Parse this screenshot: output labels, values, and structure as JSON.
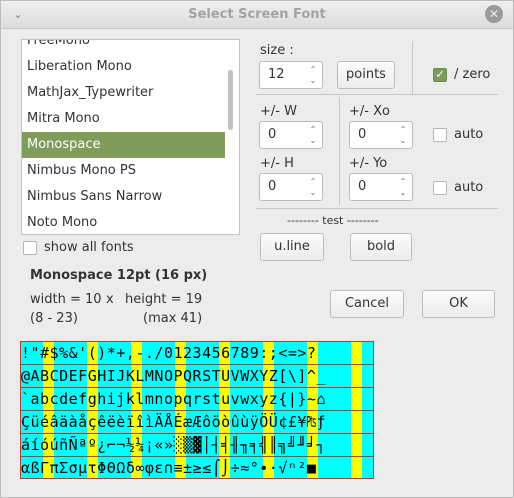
{
  "window": {
    "title": "Select Screen Font",
    "menu_icon": "chevron-down-icon",
    "close_icon": "close-icon"
  },
  "font_list": {
    "items": [
      "FreeMono",
      "Liberation Mono",
      "MathJax_Typewriter",
      "Mitra Mono",
      "Monospace",
      "Nimbus Mono PS",
      "Nimbus Sans Narrow",
      "Noto Mono"
    ],
    "selected": "Monospace"
  },
  "show_all_fonts": {
    "label": "show all fonts",
    "checked": false
  },
  "size": {
    "label": "size :",
    "value": "12",
    "unit_button": "points"
  },
  "zero": {
    "label": "/ zero",
    "checked": true
  },
  "w": {
    "label": "+/- W",
    "value": "0"
  },
  "h": {
    "label": "+/- H",
    "value": "0"
  },
  "xo": {
    "label": "+/- Xo",
    "value": "0",
    "auto_label": "auto"
  },
  "yo": {
    "label": "+/- Yo",
    "value": "0",
    "auto_label": "auto"
  },
  "test": {
    "label": "-------- test --------",
    "uline": "u.line",
    "bold": "bold"
  },
  "info": {
    "font_line": "Monospace  12pt  (16 px)",
    "width": "width = 10",
    "x": "x",
    "height": "height = 19",
    "range": "(8 - 23)",
    "max": "(max 41)"
  },
  "buttons": {
    "cancel": "Cancel",
    "ok": "OK"
  },
  "charmap_rows": [
    " !\"#$%&'()*+,-./0123456789:;<=>?",
    "@ABCDEFGHIJKLMNOPQRSTUVWXYZ[\\]^_",
    "`abcdefghijklmnopqrstuvwxyz{|}~⌂",
    "ÇüéâäàåçêëèïîìÄÅÉæÆôöòûùÿÖÜ¢£¥₧ƒ",
    "áíóúñÑªº¿⌐¬½¼¡«»░▒▓│┤╡╢╖╕╣║╗╝╜╛┐",
    "αßΓπΣσµτΦΘΩδ∞φε∩≡±≥≤⌠⌡÷≈°∙·√ⁿ²■ "
  ]
}
